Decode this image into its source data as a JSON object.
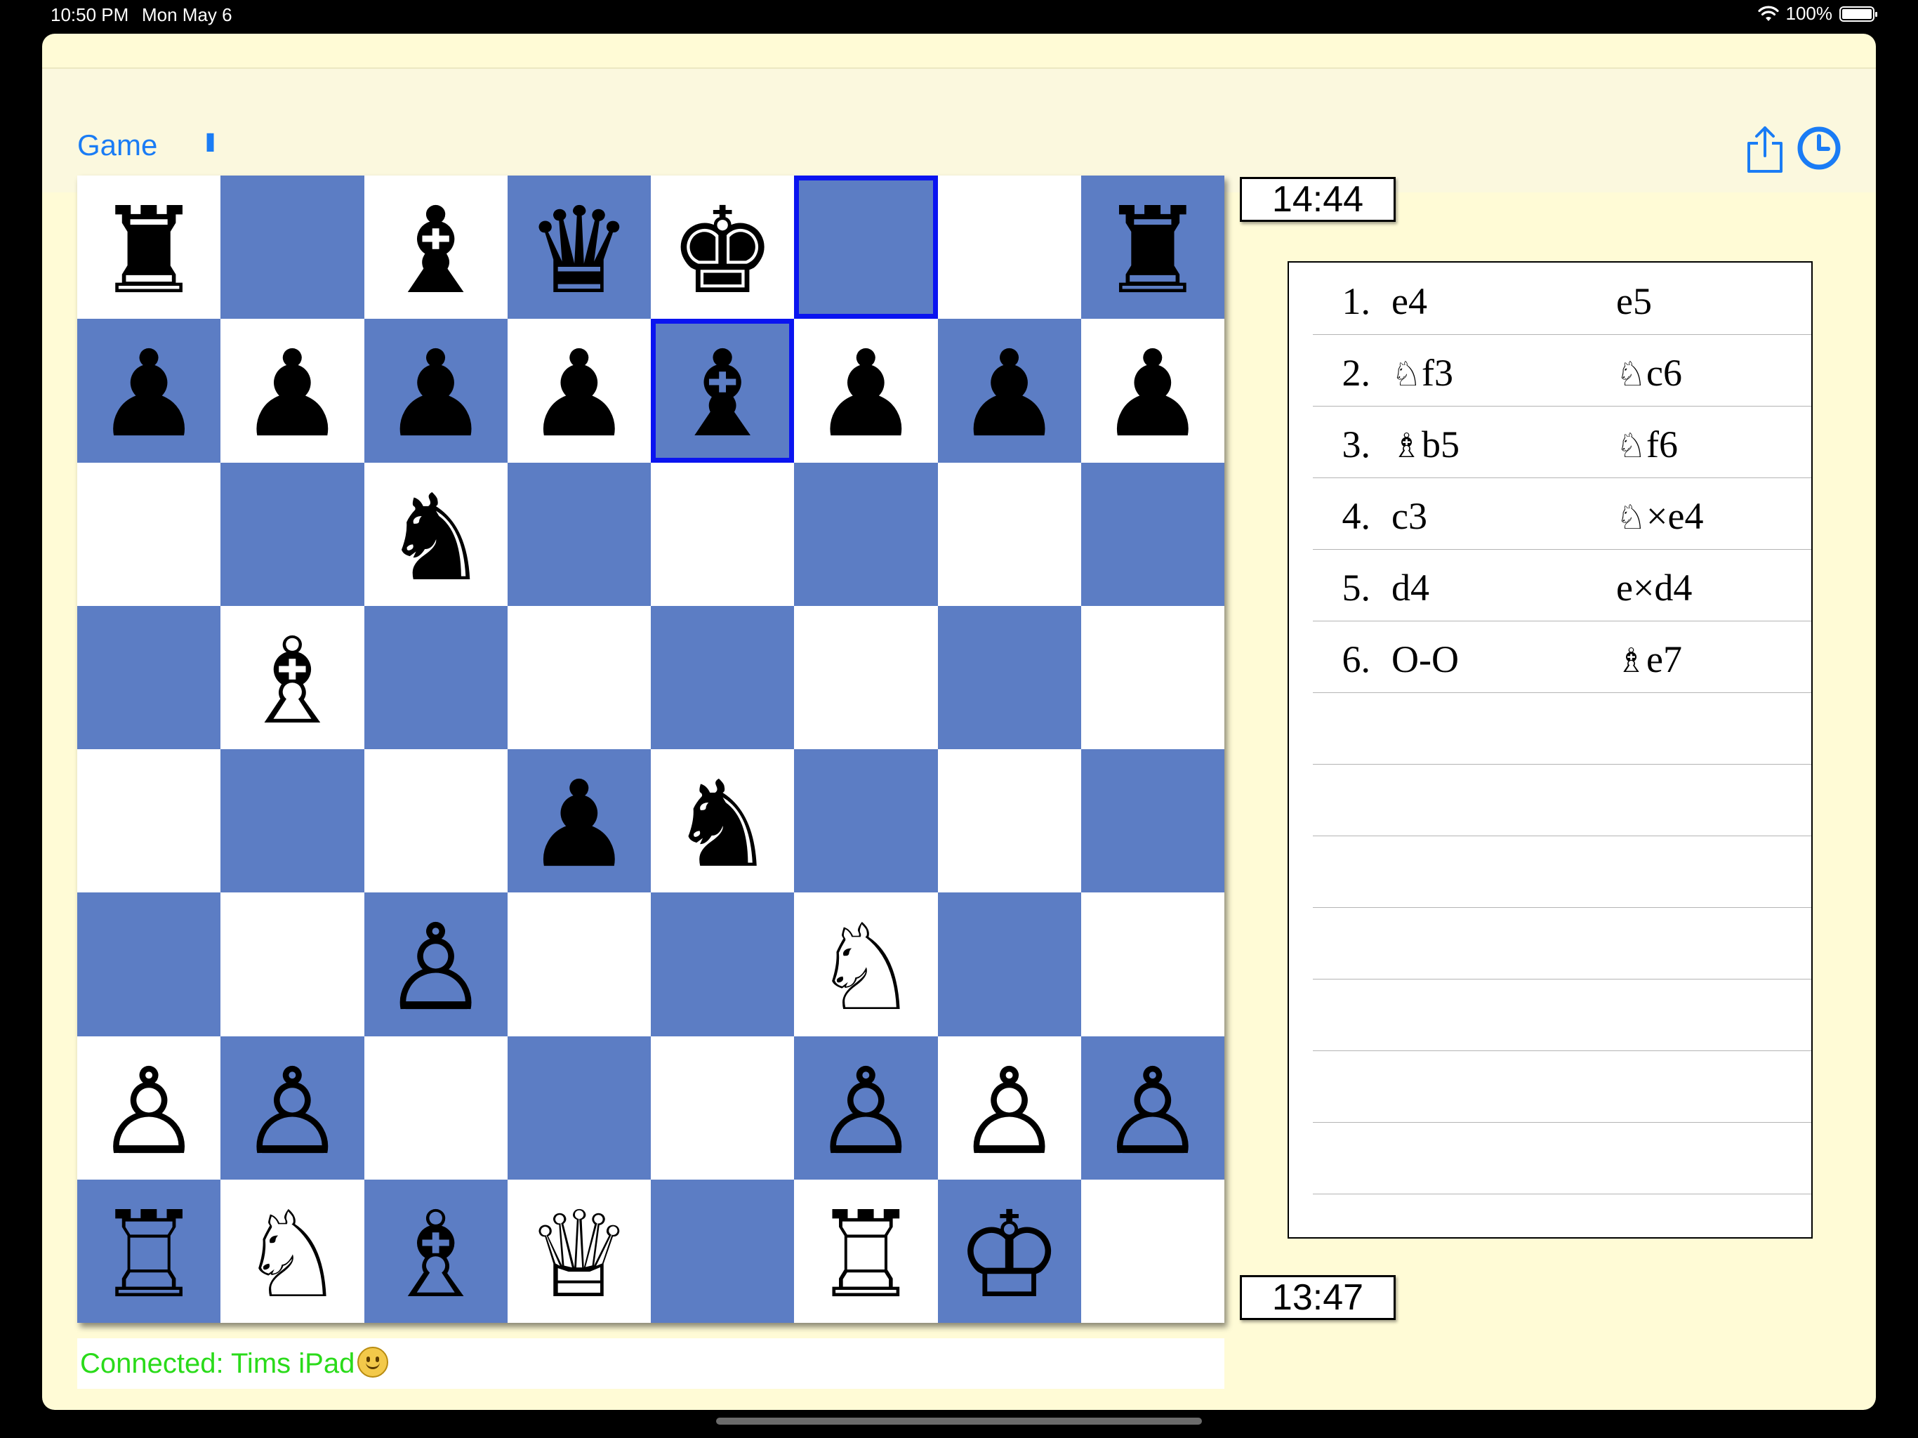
{
  "status_bar": {
    "time": "10:50 PM",
    "date": "Mon May 6",
    "battery": "100%"
  },
  "toolbar": {
    "game_label": "Game",
    "pause_label": "II"
  },
  "clocks": {
    "top": "14:44",
    "bottom": "13:47"
  },
  "status": {
    "connected": "Connected: Tims iPad"
  },
  "board": {
    "rows": [
      [
        "♜",
        "",
        "♝",
        "♛",
        "♚",
        "",
        "",
        "♜"
      ],
      [
        "♟",
        "♟",
        "♟",
        "♟",
        "♝",
        "♟",
        "♟",
        "♟"
      ],
      [
        "",
        "",
        "♞",
        "",
        "",
        "",
        "",
        ""
      ],
      [
        "",
        "♗",
        "",
        "",
        "",
        "",
        "",
        ""
      ],
      [
        "",
        "",
        "",
        "♟",
        "♞",
        "",
        "",
        ""
      ],
      [
        "",
        "",
        "♙",
        "",
        "",
        "♘",
        "",
        ""
      ],
      [
        "♙",
        "♙",
        "",
        "",
        "",
        "♙",
        "♙",
        "♙"
      ],
      [
        "♖",
        "♘",
        "♗",
        "♕",
        "",
        "♖",
        "♔",
        ""
      ]
    ],
    "highlighted_squares": [
      "f8",
      "e7"
    ],
    "light_color": "#ffffff",
    "dark_color": "#5c7dc4",
    "highlight_color": "#0a14f0"
  },
  "moves": [
    {
      "num": "1.",
      "white_piece": "",
      "white": "e4",
      "black_piece": "",
      "black": "e5"
    },
    {
      "num": "2.",
      "white_piece": "♘",
      "white": "f3",
      "black_piece": "♘",
      "black": "c6"
    },
    {
      "num": "3.",
      "white_piece": "♗",
      "white": "b5",
      "black_piece": "♘",
      "black": "f6"
    },
    {
      "num": "4.",
      "white_piece": "",
      "white": "c3",
      "black_piece": "♘",
      "black": "×e4"
    },
    {
      "num": "5.",
      "white_piece": "",
      "white": "d4",
      "black_piece": "",
      "black": "e×d4"
    },
    {
      "num": "6.",
      "white_piece": "",
      "white": "O-O",
      "black_piece": "♗",
      "black": "e7"
    }
  ],
  "move_list_empty_rows": 7,
  "colors": {
    "accent": "#1a7cf5",
    "status_green": "#2adb1a",
    "app_background": "#fffbd6"
  }
}
